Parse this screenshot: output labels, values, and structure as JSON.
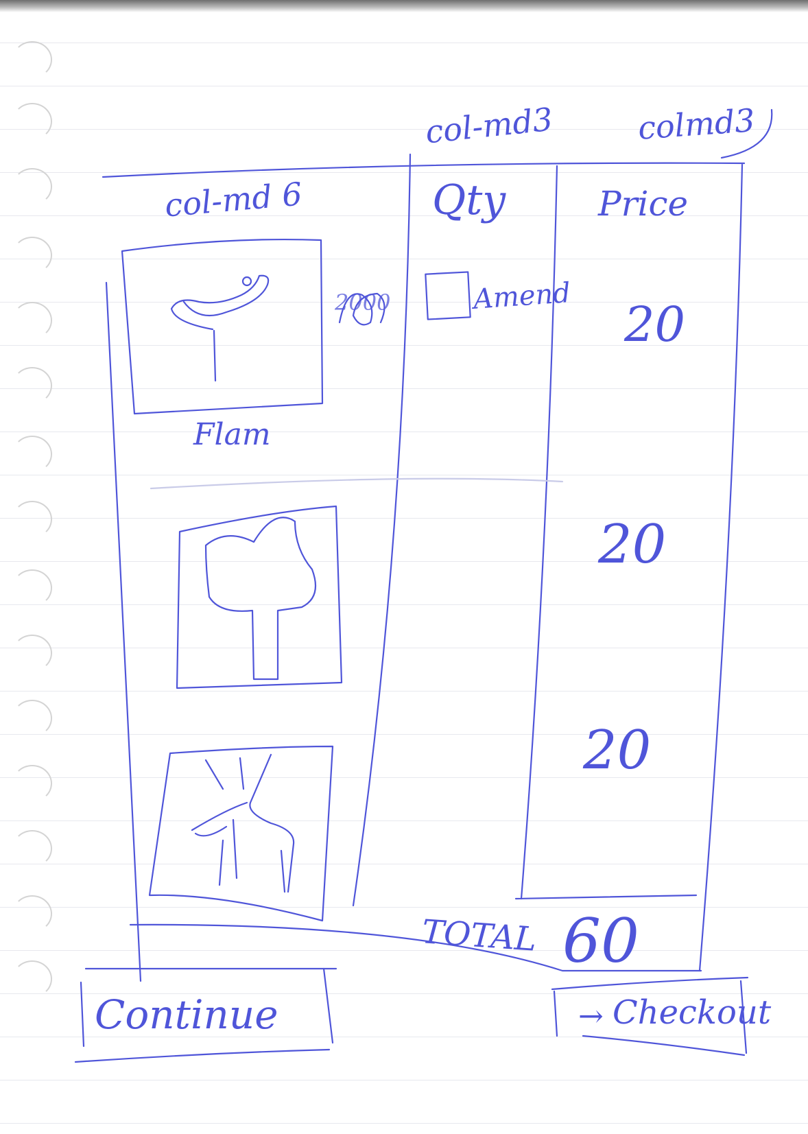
{
  "annotations": {
    "col_md3_a": "col-md3",
    "col_md3_b": "colmd3",
    "col_md6": "col-md 6"
  },
  "cart": {
    "headers": {
      "qty": "Qty",
      "price": "Price"
    },
    "items": [
      {
        "name": "Flam",
        "qty_note": "2000",
        "amend_label": "Amend",
        "price": "20",
        "image_icon": "flamingo-icon"
      },
      {
        "name": "",
        "price": "20",
        "image_icon": "tree-icon"
      },
      {
        "name": "",
        "price": "20",
        "image_icon": "deer-icon"
      }
    ],
    "total_label": "TOTAL",
    "total_value": "60"
  },
  "buttons": {
    "continue_label": "Continue",
    "checkout_label": "Checkout",
    "checkout_icon": "arrow-right-icon"
  },
  "colors": {
    "ink": "#4f55d9",
    "paper": "#ffffff",
    "rule": "#e7e8ee"
  }
}
